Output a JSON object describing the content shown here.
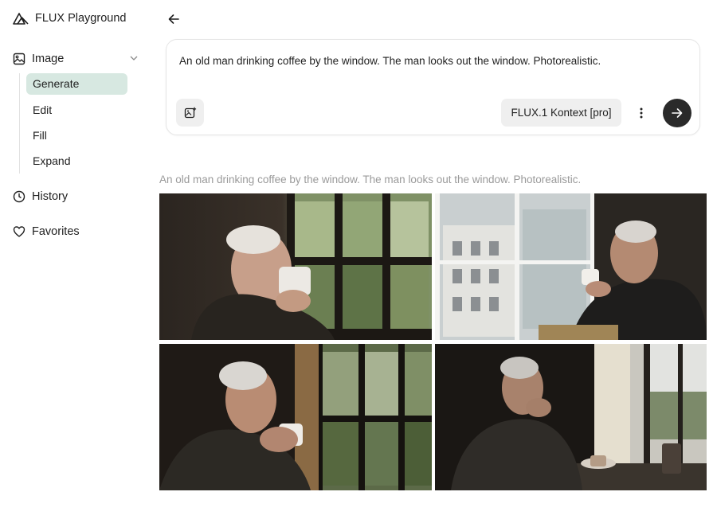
{
  "app": {
    "title": "FLUX Playground"
  },
  "sidebar": {
    "group": {
      "label": "Image",
      "icon": "image-icon"
    },
    "subitems": [
      {
        "label": "Generate",
        "active": true
      },
      {
        "label": "Edit",
        "active": false
      },
      {
        "label": "Fill",
        "active": false
      },
      {
        "label": "Expand",
        "active": false
      }
    ],
    "items": [
      {
        "label": "History",
        "icon": "clock-icon"
      },
      {
        "label": "Favorites",
        "icon": "heart-icon"
      }
    ]
  },
  "prompt": {
    "text": "An old man drinking coffee by the window. The man looks out the window. Photorealistic.",
    "model_label": "FLUX.1 Kontext [pro]"
  },
  "results": {
    "caption": "An old man drinking coffee by the window. The man looks out the window. Photorealistic.",
    "images": [
      {
        "name": "generated-image-1"
      },
      {
        "name": "generated-image-2"
      },
      {
        "name": "generated-image-3"
      },
      {
        "name": "generated-image-4"
      }
    ]
  },
  "colors": {
    "accent_active": "#d7e8e1",
    "send_button": "#2a2a2a"
  }
}
